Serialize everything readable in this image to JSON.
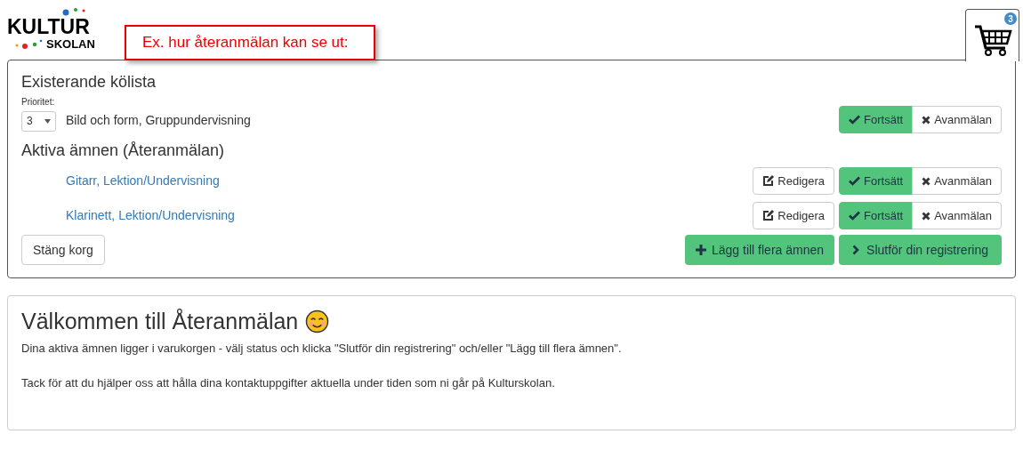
{
  "logo": {
    "line_1": "KULTUR",
    "line_2": "SKOLAN"
  },
  "annotation": "Ex. hur återanmälan kan se ut:",
  "cart": {
    "count": "3"
  },
  "queue": {
    "title": "Existerande kölista",
    "priority_label": "Prioritet:",
    "items": [
      {
        "priority": "3",
        "name": "Bild och form, Gruppundervisning",
        "options": [
          {
            "label": "Fortsätt",
            "selected": true
          },
          {
            "label": "Avanmälan",
            "selected": false
          }
        ]
      }
    ]
  },
  "active": {
    "title": "Aktiva ämnen (Återanmälan)",
    "items": [
      {
        "name": "Gitarr, Lektion/Undervisning",
        "edit": "Redigera",
        "options": [
          {
            "label": "Fortsätt",
            "selected": true
          },
          {
            "label": "Avanmälan",
            "selected": false
          }
        ]
      },
      {
        "name": "Klarinett, Lektion/Undervisning",
        "edit": "Redigera",
        "options": [
          {
            "label": "Fortsätt",
            "selected": true
          },
          {
            "label": "Avanmälan",
            "selected": false
          }
        ]
      }
    ]
  },
  "footer": {
    "close": "Stäng korg",
    "add": "Lägg till flera ämnen",
    "finish": "Slutför din registrering"
  },
  "welcome": {
    "title": "Välkommen till Återanmälan",
    "paragraphs": [
      "Dina aktiva ämnen ligger i varukorgen - välj status och klicka \"Slutför din registrering\" och/eller \"Lägg till flera ämnen\".",
      "Tack för att du hjälper oss att hålla dina kontaktuppgifter aktuella under tiden som ni går på Kulturskolan."
    ]
  }
}
